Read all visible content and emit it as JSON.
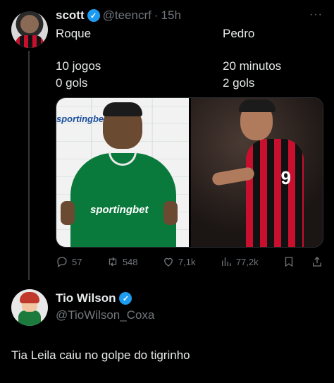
{
  "tweet1": {
    "author_name": "scott",
    "handle": "@teencrf",
    "separator": "·",
    "time": "15h",
    "col1": {
      "name": "Roque",
      "line1": "10 jogos",
      "line2": "0 gols"
    },
    "col2": {
      "name": "Pedro",
      "line1": "20 minutos",
      "line2": "2 gols"
    },
    "media": {
      "left": {
        "sponsor_text": "sportingbet",
        "shirt_text": "sportingbet"
      },
      "right": {
        "shirt_number": "9"
      }
    },
    "actions": {
      "replies": "57",
      "retweets": "548",
      "likes": "7,1k",
      "views": "77,2k"
    }
  },
  "tweet2": {
    "author_name": "Tio Wilson",
    "handle": "@TioWilson_Coxa",
    "text": "Tia Leila caiu no golpe do tigrinho"
  },
  "icons": {
    "verified": "verified-badge-icon",
    "more": "more-options-icon",
    "reply": "reply-icon",
    "retweet": "retweet-icon",
    "like": "heart-icon",
    "views": "views-icon",
    "bookmark": "bookmark-icon",
    "share": "share-icon"
  },
  "colors": {
    "verified": "#1d9bf0",
    "muted": "#71767b",
    "text": "#e7e9ea",
    "background": "#000000"
  }
}
